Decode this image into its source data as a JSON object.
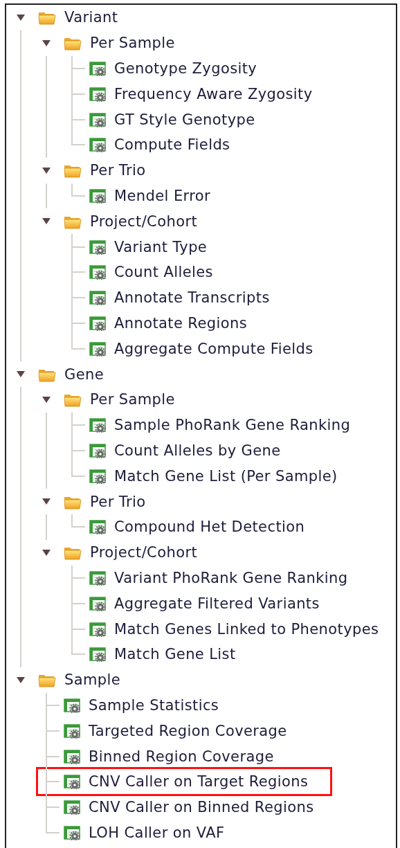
{
  "tree": [
    {
      "kind": "folder",
      "label": "Variant",
      "expanded": true,
      "highlighted": false,
      "children": [
        {
          "kind": "folder",
          "label": "Per Sample",
          "expanded": true,
          "highlighted": false,
          "children": [
            {
              "kind": "leaf",
              "label": "Genotype Zygosity",
              "highlighted": false
            },
            {
              "kind": "leaf",
              "label": "Frequency Aware Zygosity",
              "highlighted": false
            },
            {
              "kind": "leaf",
              "label": "GT Style Genotype",
              "highlighted": false
            },
            {
              "kind": "leaf",
              "label": "Compute Fields",
              "highlighted": false
            }
          ]
        },
        {
          "kind": "folder",
          "label": "Per Trio",
          "expanded": true,
          "highlighted": false,
          "children": [
            {
              "kind": "leaf",
              "label": "Mendel Error",
              "highlighted": false
            }
          ]
        },
        {
          "kind": "folder",
          "label": "Project/Cohort",
          "expanded": true,
          "highlighted": false,
          "children": [
            {
              "kind": "leaf",
              "label": "Variant Type",
              "highlighted": false
            },
            {
              "kind": "leaf",
              "label": "Count Alleles",
              "highlighted": false
            },
            {
              "kind": "leaf",
              "label": "Annotate Transcripts",
              "highlighted": false
            },
            {
              "kind": "leaf",
              "label": "Annotate Regions",
              "highlighted": false
            },
            {
              "kind": "leaf",
              "label": "Aggregate Compute Fields",
              "highlighted": false
            }
          ]
        }
      ]
    },
    {
      "kind": "folder",
      "label": "Gene",
      "expanded": true,
      "highlighted": false,
      "children": [
        {
          "kind": "folder",
          "label": "Per Sample",
          "expanded": true,
          "highlighted": false,
          "children": [
            {
              "kind": "leaf",
              "label": "Sample PhoRank Gene Ranking",
              "highlighted": false
            },
            {
              "kind": "leaf",
              "label": "Count Alleles by Gene",
              "highlighted": false
            },
            {
              "kind": "leaf",
              "label": "Match Gene List (Per Sample)",
              "highlighted": false
            }
          ]
        },
        {
          "kind": "folder",
          "label": "Per Trio",
          "expanded": true,
          "highlighted": false,
          "children": [
            {
              "kind": "leaf",
              "label": "Compound Het Detection",
              "highlighted": false
            }
          ]
        },
        {
          "kind": "folder",
          "label": "Project/Cohort",
          "expanded": true,
          "highlighted": false,
          "children": [
            {
              "kind": "leaf",
              "label": "Variant PhoRank Gene Ranking",
              "highlighted": false
            },
            {
              "kind": "leaf",
              "label": "Aggregate Filtered Variants",
              "highlighted": false
            },
            {
              "kind": "leaf",
              "label": "Match Genes Linked to Phenotypes",
              "highlighted": false
            },
            {
              "kind": "leaf",
              "label": "Match Gene List",
              "highlighted": false
            }
          ]
        }
      ]
    },
    {
      "kind": "folder",
      "label": "Sample",
      "expanded": true,
      "highlighted": false,
      "children": [
        {
          "kind": "leaf",
          "label": "Sample Statistics",
          "highlighted": false
        },
        {
          "kind": "leaf",
          "label": "Targeted Region Coverage",
          "highlighted": false
        },
        {
          "kind": "leaf",
          "label": "Binned Region Coverage",
          "highlighted": false
        },
        {
          "kind": "leaf",
          "label": "CNV Caller on Target Regions",
          "highlighted": true
        },
        {
          "kind": "leaf",
          "label": "CNV Caller on Binned Regions",
          "highlighted": false
        },
        {
          "kind": "leaf",
          "label": "LOH Caller on VAF",
          "highlighted": false
        }
      ]
    }
  ]
}
